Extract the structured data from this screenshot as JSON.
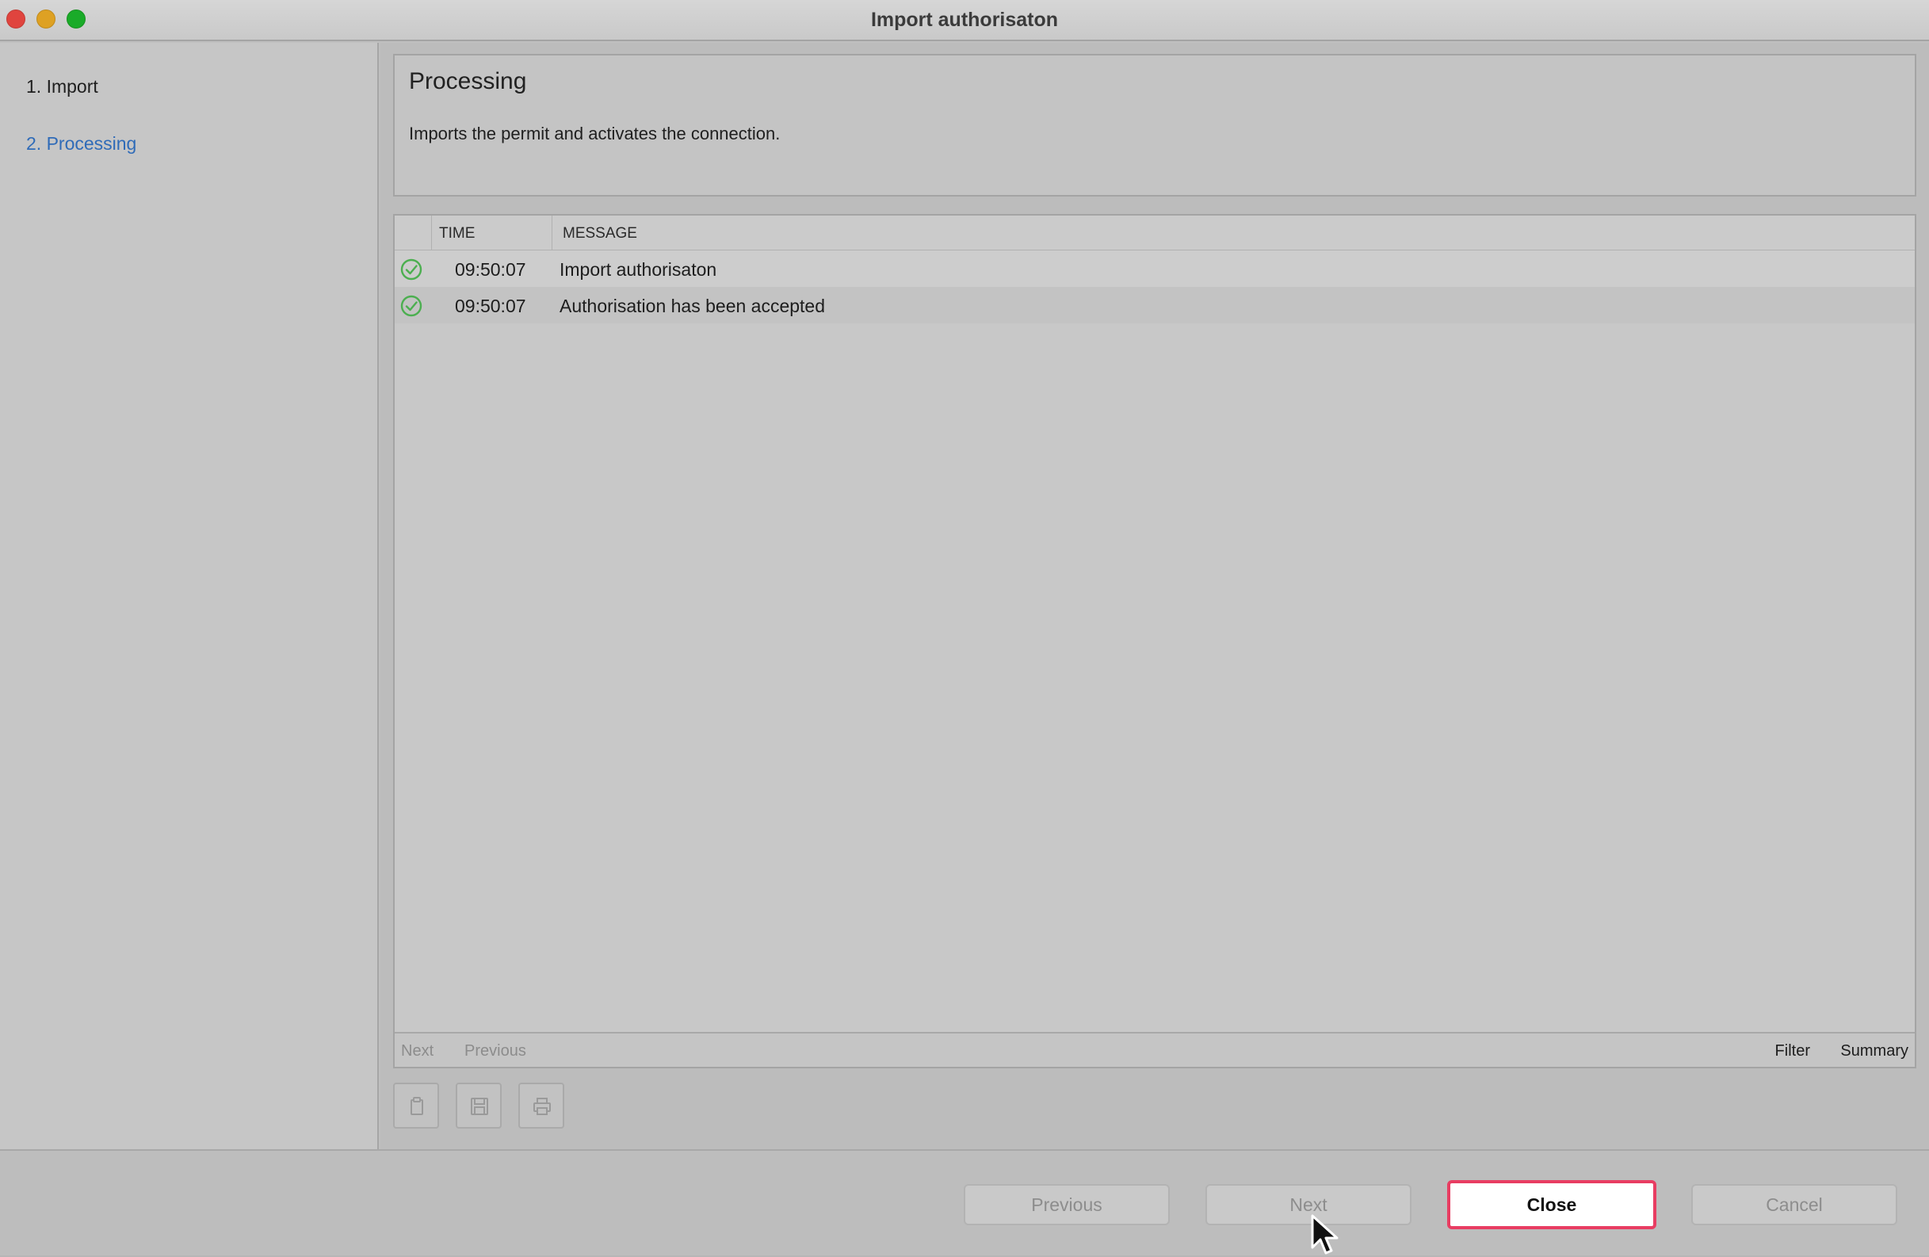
{
  "window": {
    "title": "Import authorisaton"
  },
  "steps": [
    {
      "label": "1. Import"
    },
    {
      "label": "2. Processing"
    }
  ],
  "header": {
    "title": "Processing",
    "description": "Imports the permit and activates the connection."
  },
  "log": {
    "columns": {
      "time": "TIME",
      "message": "MESSAGE"
    },
    "rows": [
      {
        "status_icon": "success-check-icon",
        "time": "09:50:07",
        "message": "Import authorisaton"
      },
      {
        "status_icon": "success-check-icon",
        "time": "09:50:07",
        "message": "Authorisation has been accepted"
      }
    ],
    "footer": {
      "next": "Next",
      "previous": "Previous",
      "filter": "Filter",
      "summary": "Summary"
    }
  },
  "toolbar": [
    {
      "icon": "copy-icon"
    },
    {
      "icon": "save-icon"
    },
    {
      "icon": "print-icon"
    }
  ],
  "buttons": {
    "previous": "Previous",
    "next": "Next",
    "close": "Close",
    "cancel": "Cancel"
  },
  "colors": {
    "active_step": "#2f6bb8",
    "success": "#4caf50",
    "highlight": "#e83d62"
  }
}
